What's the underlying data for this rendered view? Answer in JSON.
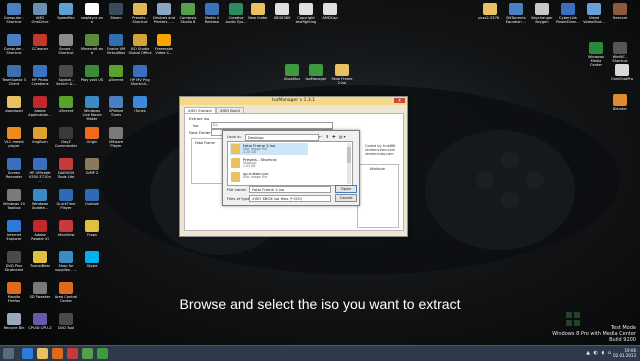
{
  "desktop": {
    "caption": "Browse and select the iso you want to extract",
    "watermark": [
      "Test Mode",
      "Windows 8 Pro with Media Center",
      "Build 9200"
    ],
    "icons": [
      {
        "id": "computer",
        "label": "Computer - Shortcut",
        "color": "#4a7fc1"
      },
      {
        "id": "amd",
        "label": "AMD OneDrive",
        "color": "#6b8fb3"
      },
      {
        "id": "speedfan",
        "label": "SpeedFan",
        "color": "#5fa0d0"
      },
      {
        "id": "xpadder",
        "label": "xwplaync.exe",
        "color": "#ffffff"
      },
      {
        "id": "steam",
        "label": "Steam",
        "color": "#3b4a5a"
      },
      {
        "id": "presets",
        "label": "Presets - Shortcut",
        "color": "#e0b85a"
      },
      {
        "id": "devices",
        "label": "Devices and Printers - ...",
        "color": "#8aa6c2"
      },
      {
        "id": "camtasia",
        "label": "Camtasia Studio 8",
        "color": "#56a04b"
      },
      {
        "id": "medio",
        "label": "Medio 4 Release",
        "color": "#3c73b8"
      },
      {
        "id": "creative",
        "label": "Creative Audio Sys...",
        "color": "#2e8a5f"
      },
      {
        "id": "newfolder",
        "label": "New folder",
        "color": "#e9c062"
      },
      {
        "id": "xbox360",
        "label": "XBOX360",
        "color": "#e0e0e0"
      },
      {
        "id": "copyright",
        "label": "Copyright testfighting",
        "color": "#e0e0e0"
      },
      {
        "id": "amdcap",
        "label": "AMDCap",
        "color": "#e0e0e0"
      },
      {
        "id": "pcsx2",
        "label": "pcsx2-5576 -",
        "color": "#e9c062"
      },
      {
        "id": "bitt",
        "label": "BitTorrents Equation ...",
        "color": "#4a7fc1"
      },
      {
        "id": "keychanger",
        "label": "Keychanger Keygen",
        "color": "#c8c8c8"
      },
      {
        "id": "cyberlink",
        "label": "CyberLink PowerDirec...",
        "color": "#3a6ebf"
      },
      {
        "id": "ulead",
        "label": "Ulead VideoStud...",
        "color": "#6aa0d8"
      },
      {
        "id": "hexcore",
        "label": "Hexcore",
        "color": "#8a5a3a"
      },
      {
        "id": "computer2",
        "label": "Computer - Shortcut",
        "color": "#4a7fc1"
      },
      {
        "id": "ccleaner",
        "label": "CCleaner",
        "color": "#c0392b"
      },
      {
        "id": "sound",
        "label": "Sound - Shortcut",
        "color": "#8c8c8c"
      },
      {
        "id": "minecraft",
        "label": "Minecraft.exe",
        "color": "#5a8a3a"
      },
      {
        "id": "oracle",
        "label": "Oracle VM VirtualBox",
        "color": "#2f6fb0"
      },
      {
        "id": "iso",
        "label": "ISO Studio Global Office",
        "color": "#d6a23a"
      },
      {
        "id": "fl",
        "label": "Freemake Video C...",
        "color": "#f7a600"
      },
      {
        "id": "wmc",
        "label": "Windows Media Center",
        "color": "#2a8a3a"
      },
      {
        "id": "winmc",
        "label": "WinMC - Shortcut",
        "color": "#555555"
      },
      {
        "id": "teamspeak",
        "label": "TeamSpeak 3 Client",
        "color": "#3d6fa8"
      },
      {
        "id": "hpcreations",
        "label": "HP Photo Creations",
        "color": "#3a74c4"
      },
      {
        "id": "spybot",
        "label": "Spybot - Search &...",
        "color": "#4a4a4a"
      },
      {
        "id": "playvol",
        "label": "Play vol4 US",
        "color": "#3a8a3a"
      },
      {
        "id": "utorrent",
        "label": "μTorrent",
        "color": "#59a32c"
      },
      {
        "id": "hpmv",
        "label": "HP MV Png Shortcut...",
        "color": "#3a6ebf"
      },
      {
        "id": "xbxlogo",
        "label": "XboxMus",
        "color": "#3e9a3e"
      },
      {
        "id": "isomanager",
        "label": "IsoManager",
        "color": "#3e9a3e"
      },
      {
        "id": "fatal",
        "label": "Fatal Frame 2.iso",
        "color": "#e9c062"
      },
      {
        "id": "camshot",
        "label": "CamShotPro",
        "color": "#d8d8d8"
      },
      {
        "id": "download",
        "label": "download",
        "color": "#e9c062"
      },
      {
        "id": "adobe",
        "label": "Adobe Application...",
        "color": "#c1272d"
      },
      {
        "id": "utorrent2",
        "label": "uTorrent",
        "color": "#59a32c"
      },
      {
        "id": "mymovie",
        "label": "Windows Live Movie Maker",
        "color": "#3a8ac4"
      },
      {
        "id": "hpvideo",
        "label": "SPWave Tunes",
        "color": "#4a7fc1"
      },
      {
        "id": "itunes",
        "label": "iTunes",
        "color": "#3a8ad8"
      },
      {
        "id": "blender",
        "label": "Blender",
        "color": "#e08a2a"
      },
      {
        "id": "vlc",
        "label": "VLC media player",
        "color": "#f08a1c"
      },
      {
        "id": "imgburn",
        "label": "ImgBurn",
        "color": "#e0a030"
      },
      {
        "id": "dayz",
        "label": "DayZ Commander",
        "color": "#3a3a3a"
      },
      {
        "id": "origin",
        "label": "Origin",
        "color": "#f06a1c"
      },
      {
        "id": "vmware",
        "label": "VMware Player",
        "color": "#7a7a7a"
      },
      {
        "id": "screen",
        "label": "Screen Recorder",
        "color": "#3a6ebf"
      },
      {
        "id": "hpofficejet",
        "label": "HP Officejet K550 E710n ...",
        "color": "#3a6ebf"
      },
      {
        "id": "daemon",
        "label": "DAEMON Tools Lite",
        "color": "#c83a3a"
      },
      {
        "id": "wintoolbox",
        "label": "Windows 10 Toolbox",
        "color": "#7a7a7a"
      },
      {
        "id": "wupdate",
        "label": "Windows Update...",
        "color": "#3a8ac4"
      },
      {
        "id": "quicktime",
        "label": "QuickTime Player",
        "color": "#2e6ab8"
      },
      {
        "id": "gimp",
        "label": "GIMP 2",
        "color": "#8a7a5a"
      },
      {
        "id": "ie",
        "label": "Internet Explorer",
        "color": "#2e7ad8"
      },
      {
        "id": "adobereader",
        "label": "Adobe Reader XI",
        "color": "#c1272d"
      },
      {
        "id": "irfanview",
        "label": "IrfanView",
        "color": "#c83a3a"
      },
      {
        "id": "outlook",
        "label": "Outlook",
        "color": "#2e6ab8"
      },
      {
        "id": "dvdplus",
        "label": "DVD Plus Stratcome",
        "color": "#4a4a4a"
      },
      {
        "id": "tunnelbear",
        "label": "TunnelBear",
        "color": "#e0c040"
      },
      {
        "id": "shop",
        "label": "Shop for supplies - ...",
        "color": "#3a8ac4"
      },
      {
        "id": "fraps",
        "label": "Fraps",
        "color": "#e0c040"
      },
      {
        "id": "mozilla",
        "label": "Mozilla Firefox",
        "color": "#e06a1c"
      },
      {
        "id": "sdtweak",
        "label": "SD Tweaker",
        "color": "#7a7a7a"
      },
      {
        "id": "avast",
        "label": "Area Control Center",
        "color": "#e06a1c"
      },
      {
        "id": "skype",
        "label": "Skype",
        "color": "#00aff0"
      },
      {
        "id": "recycle",
        "label": "Recycle Bin",
        "color": "#9aa8b8"
      },
      {
        "id": "cpuid",
        "label": "CPUID CPU-Z",
        "color": "#6a5aa8"
      },
      {
        "id": "dvd",
        "label": "DVD Tool",
        "color": "#4a4a4a"
      }
    ]
  },
  "window": {
    "title": "IsoManager v 1.3.1",
    "close": "X",
    "tabs": [
      "XISO Extract",
      "XISO Build"
    ],
    "extract_iso_label": "Extract iso",
    "iso_label": "Iso",
    "iso_value": "C:\\",
    "dest_label": "Dest Folder",
    "tree_item": "Fatal Frame",
    "side_text": [
      "Coded by truk88t",
      "xtreemvxtro.com",
      "xtreemcoto.com"
    ],
    "attribute_label": "Attribute"
  },
  "dialog": {
    "look_in_label": "Look in:",
    "look_in_value": "Desktop",
    "tools": "← ⬆ ✚ ▤▾",
    "files": [
      {
        "name": "Fatal Frame 2.iso",
        "type": "Disc Image File",
        "size": "4.20 GB",
        "color": "#e9c062",
        "selected": true
      },
      {
        "name": "Presets - Shortcut",
        "type": "Shortcut",
        "size": "1.03 KB",
        "color": "#e9c062",
        "selected": false
      },
      {
        "name": "vp-mikom.iso",
        "type": "Disc Image File",
        "size": "",
        "color": "#e9c062",
        "selected": false
      }
    ],
    "file_name_label": "File name:",
    "file_name_value": "Fatal Frame 2.iso",
    "file_type_label": "Files of type:",
    "file_type_value": "XISO XBOX iso files (*.ISO)",
    "open": "Open",
    "cancel": "Cancel"
  },
  "taskbar": {
    "time": "19:06",
    "date": "02.01.2013",
    "buttons": [
      {
        "name": "ie-taskbar-icon",
        "color": "#2e7ad8"
      },
      {
        "name": "explorer-taskbar-icon",
        "color": "#e9c062"
      },
      {
        "name": "firefox-taskbar-icon",
        "color": "#e06a1c"
      },
      {
        "name": "media-taskbar-icon",
        "color": "#c83a3a"
      },
      {
        "name": "camtasia-taskbar-icon",
        "color": "#56a04b"
      },
      {
        "name": "isomanager-taskbar-icon",
        "color": "#3e9a3e"
      }
    ]
  }
}
